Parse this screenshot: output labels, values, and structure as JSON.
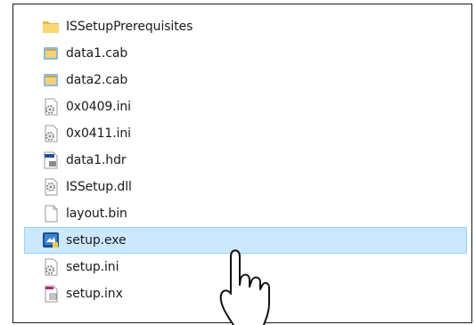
{
  "files": [
    {
      "name": "ISSetupPrerequisites",
      "icon": "folder-icon",
      "selected": false
    },
    {
      "name": "data1.cab",
      "icon": "cabinet-file-icon",
      "selected": false
    },
    {
      "name": "data2.cab",
      "icon": "cabinet-file-icon",
      "selected": false
    },
    {
      "name": "0x0409.ini",
      "icon": "settings-file-icon",
      "selected": false
    },
    {
      "name": "0x0411.ini",
      "icon": "settings-file-icon",
      "selected": false
    },
    {
      "name": "data1.hdr",
      "icon": "hdr-file-icon",
      "selected": false
    },
    {
      "name": "ISSetup.dll",
      "icon": "dll-file-icon",
      "selected": false
    },
    {
      "name": "layout.bin",
      "icon": "blank-file-icon",
      "selected": false
    },
    {
      "name": "setup.exe",
      "icon": "setup-exe-icon",
      "selected": true
    },
    {
      "name": "setup.ini",
      "icon": "settings-file-icon",
      "selected": false
    },
    {
      "name": "setup.inx",
      "icon": "inx-file-icon",
      "selected": false
    }
  ],
  "colors": {
    "selection_bg": "#cce8ff",
    "selection_border": "#99d1ff",
    "folder": "#f8d775"
  },
  "cursor": {
    "icon": "hand-pointer-icon"
  }
}
